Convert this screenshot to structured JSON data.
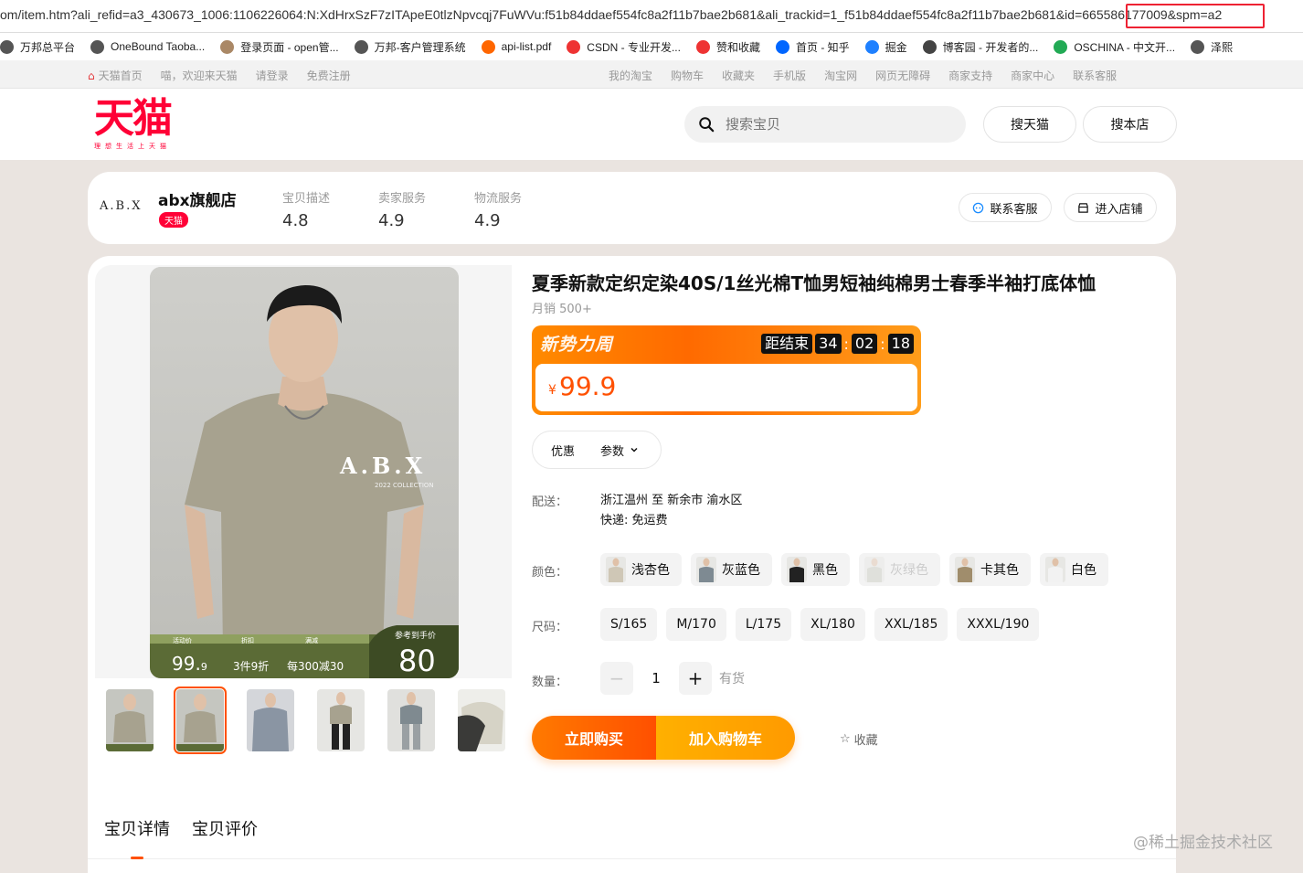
{
  "browser": {
    "url": "om/item.htm?ali_refid=a3_430673_1006:1106226064:N:XdHrxSzF7zITApeE0tlzNpvcqj7FuWVu:f51b84ddaef554fc8a2f11b7bae2b681&ali_trackid=1_f51b84ddaef554fc8a2f11b7bae2b681&id=665586177009&spm=a2",
    "bookmarks": [
      {
        "label": "万邦总平台",
        "icon": "globe-icon",
        "color": "#555"
      },
      {
        "label": "OneBound Taoba...",
        "icon": "globe-icon",
        "color": "#555"
      },
      {
        "label": "登录页面 - open管...",
        "icon": "image-icon",
        "color": "#a86"
      },
      {
        "label": "万邦-客户管理系统",
        "icon": "globe-icon",
        "color": "#555"
      },
      {
        "label": "api-list.pdf",
        "icon": "pdf-icon",
        "color": "#f60"
      },
      {
        "label": "CSDN - 专业开发...",
        "icon": "csdn-icon",
        "color": "#e33"
      },
      {
        "label": "赞和收藏",
        "icon": "csdn-icon",
        "color": "#e33"
      },
      {
        "label": "首页 - 知乎",
        "icon": "zhihu-icon",
        "color": "#06f"
      },
      {
        "label": "掘金",
        "icon": "juejin-icon",
        "color": "#1e80ff"
      },
      {
        "label": "博客园 - 开发者的...",
        "icon": "cnblogs-icon",
        "color": "#444"
      },
      {
        "label": "OSCHINA - 中文开...",
        "icon": "oschina-icon",
        "color": "#2a5"
      },
      {
        "label": "泽熙",
        "icon": "globe-icon",
        "color": "#555"
      }
    ]
  },
  "topnav": {
    "home": "天猫首页",
    "welcome": "喵，欢迎来天猫",
    "login": "请登录",
    "register": "免费注册",
    "right": [
      "我的淘宝",
      "购物车",
      "收藏夹",
      "手机版",
      "淘宝网",
      "网页无障碍",
      "商家支持",
      "商家中心",
      "联系客服"
    ]
  },
  "header": {
    "logo": "天猫",
    "logo_sub": "理想生活上天猫",
    "search_placeholder": "搜索宝贝",
    "search_tmall": "搜天猫",
    "search_shop": "搜本店"
  },
  "shop": {
    "logo_text": "A.B.X",
    "name": "abx旗舰店",
    "badge": "天猫",
    "stats": [
      {
        "label": "宝贝描述",
        "value": "4.8"
      },
      {
        "label": "卖家服务",
        "value": "4.9"
      },
      {
        "label": "物流服务",
        "value": "4.9"
      }
    ],
    "contact": "联系客服",
    "enter": "进入店铺"
  },
  "product": {
    "title": "夏季新款定织定染40S/1丝光棉T恤男短袖纯棉男士春季半袖打底体恤",
    "sales": "月销 500+",
    "promo_tag": "新势力周",
    "countdown_label": "距结束",
    "countdown": [
      "34",
      "02",
      "18"
    ],
    "currency": "¥",
    "price": "99.9",
    "tab_discount": "优惠",
    "tab_params": "参数",
    "delivery_label": "配送：",
    "delivery_route": "浙江温州 至 新余市 渝水区",
    "delivery_fee": "快递: 免运费",
    "color_label": "颜色：",
    "colors": [
      {
        "name": "浅杏色",
        "swatch": "#cfc7b6",
        "disabled": false
      },
      {
        "name": "灰蓝色",
        "swatch": "#7e8a92",
        "disabled": false
      },
      {
        "name": "黑色",
        "swatch": "#222222",
        "disabled": false
      },
      {
        "name": "灰绿色",
        "swatch": "#c8cbc0",
        "disabled": true
      },
      {
        "name": "卡其色",
        "swatch": "#a08d6c",
        "disabled": false
      },
      {
        "name": "白色",
        "swatch": "#f2f2f2",
        "disabled": false
      }
    ],
    "size_label": "尺码：",
    "sizes": [
      "S/165",
      "M/170",
      "L/175",
      "XL/180",
      "XXL/185",
      "XXXL/190"
    ],
    "qty_label": "数量：",
    "qty": "1",
    "stock": "有货",
    "buy_now": "立即购买",
    "add_cart": "加入购物车",
    "favorite": "收藏"
  },
  "image_overlay": {
    "brand": "A.B.X",
    "brand_sub": "2022 COLLECTION",
    "labels": [
      "活动价",
      "折扣",
      "满减",
      "参考到手价"
    ],
    "price_big": "99.",
    "price_small": "9",
    "discount": "3件9折",
    "reduction": "每300减30",
    "final": "80"
  },
  "bottom_tabs": [
    "宝贝详情",
    "宝贝评价"
  ],
  "watermark": "@稀土掘金技术社区",
  "colors": {
    "accent": "#ff5000",
    "tmall_red": "#ff0036",
    "orange": "#ff8a00"
  }
}
